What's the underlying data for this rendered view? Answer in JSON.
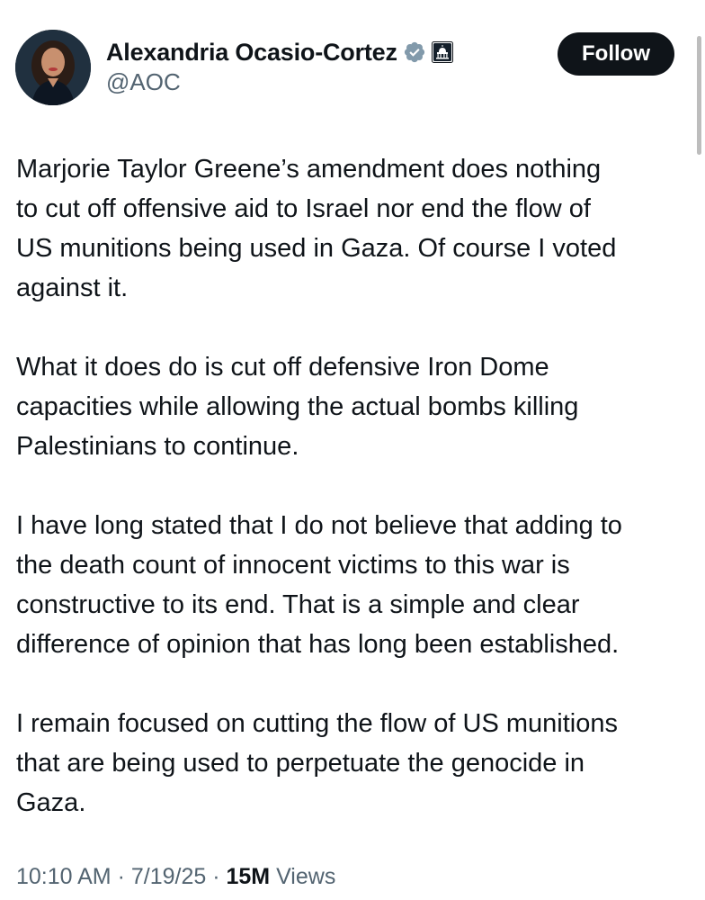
{
  "author": {
    "display_name": "Alexandria Ocasio-Cortez",
    "handle": "@AOC",
    "verified_icon": "verified-badge-icon",
    "affiliation_icon": "capitol-dome-icon"
  },
  "follow_label": "Follow",
  "tweet": {
    "paragraphs": [
      {
        "lines": [
          "Marjorie Taylor Greene’s amendment does nothing",
          "to cut off offensive aid to Israel nor end the flow of",
          "US munitions being used in Gaza. Of course I voted",
          "against it."
        ]
      },
      {
        "lines": [
          "What it does do is cut off defensive Iron Dome",
          "capacities while allowing the actual bombs killing",
          "Palestinians to continue."
        ]
      },
      {
        "lines": [
          "I have long stated that I do not believe that adding to",
          "the death count of innocent victims to this war is",
          "constructive to its end. That is a simple and clear",
          "difference of opinion that has long been established."
        ]
      },
      {
        "lines": [
          "I remain focused on cutting the flow of US munitions",
          "that are being used to perpetuate the genocide in",
          "Gaza."
        ]
      }
    ]
  },
  "meta": {
    "time": "10:10 AM",
    "separator": " · ",
    "date": "7/19/25",
    "views_count": "15M",
    "views_label": " Views"
  },
  "colors": {
    "text": "#0f1419",
    "secondary": "#536471",
    "follow_bg": "#0f1419",
    "verified": "#829aab"
  }
}
